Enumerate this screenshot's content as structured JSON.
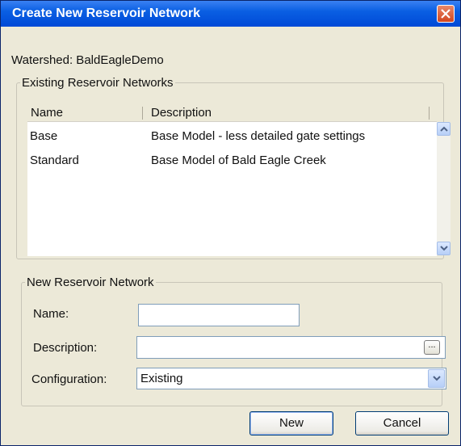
{
  "window": {
    "title": "Create New Reservoir Network"
  },
  "watershed": {
    "text": "Watershed: BaldEagleDemo"
  },
  "existing": {
    "group_label": "Existing Reservoir Networks",
    "columns": [
      "Name",
      "Description"
    ],
    "rows": [
      {
        "name": "Base",
        "description": "Base Model - less detailed gate settings"
      },
      {
        "name": "Standard",
        "description": "Base Model of Bald Eagle Creek"
      }
    ]
  },
  "new_network": {
    "group_label": "New Reservoir Network",
    "name_label": "Name:",
    "name_value": "",
    "description_label": "Description:",
    "description_value": "",
    "browse_label": "...",
    "configuration_label": "Configuration:",
    "configuration_value": "Existing"
  },
  "buttons": {
    "new": "New",
    "cancel": "Cancel"
  },
  "icons": {
    "close": "close-icon",
    "scroll_up": "arrow-up-icon",
    "scroll_down": "arrow-down-icon",
    "dropdown": "chevron-down-icon"
  },
  "colors": {
    "titlebar": "#0a5fe3",
    "dialog_bg": "#ece9d8",
    "close_button": "#d2461f"
  }
}
